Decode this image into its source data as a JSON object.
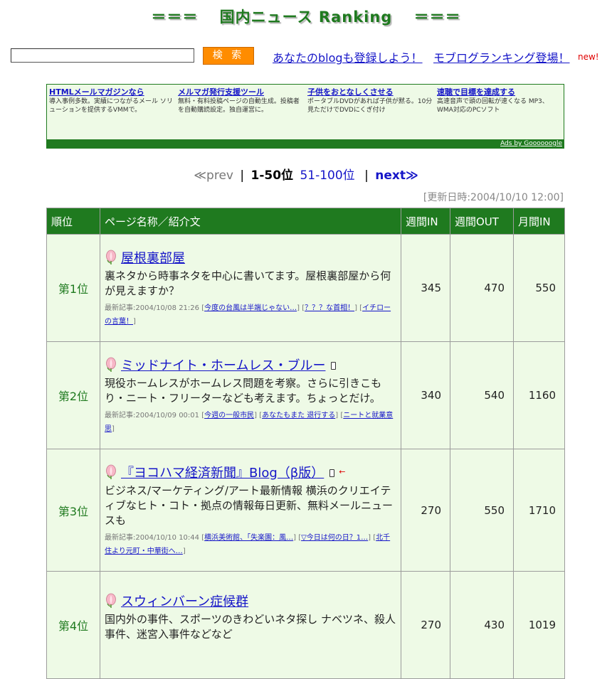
{
  "header": {
    "title": "＝＝＝　 国内ニュース Ranking　 ＝＝＝"
  },
  "search": {
    "button_label": "検 索",
    "value": ""
  },
  "top_links": {
    "register": "あなたのblogも登録しよう！",
    "mobile_ranking": "モブログランキング登場！",
    "new_badge": "new!"
  },
  "ads": {
    "items": [
      {
        "title": "HTMLメールマガジンなら",
        "desc": "導入事例多数。実績につながるメール ソリューションを提供するVMMで。"
      },
      {
        "title": "メルマガ発行支援ツール",
        "desc": "無料・有料投稿ページの自動生成。投稿者を自動購読設定。独自運営に。"
      },
      {
        "title": "子供をおとなしくさせる",
        "desc": "ポータブルDVDがあれば子供が黙る。10分見ただけでDVDにくぎ付け"
      },
      {
        "title": "速聴で目標を達成する",
        "desc": "高速音声で頭の回転が速くなる MP3、WMA対応のPCソフト"
      }
    ],
    "credit": "Ads by Goooooogle"
  },
  "pager": {
    "prev": "≪prev",
    "sep": "|",
    "current": "1-50位",
    "range2": "51-100位",
    "next": "next≫"
  },
  "updated": "[更新日時:2004/10/10 12:00]",
  "table": {
    "headers": [
      "順位",
      "ページ名称／紹介文",
      "週間IN",
      "週間OUT",
      "月間IN"
    ],
    "rows": [
      {
        "rank": "第1位",
        "name": "屋根裏部屋",
        "intro": "裏ネタから時事ネタを中心に書いてます。屋根裏部屋から何が見えますか？",
        "recent_label": "最新記事:",
        "recent_time": "2004/10/08 21:26",
        "articles": [
          "今度の台風は半端じゃない…",
          "？？？な首相！",
          "イチローの言葉！"
        ],
        "week_in": "345",
        "week_out": "470",
        "month_in": "550"
      },
      {
        "rank": "第2位",
        "name": "ミッドナイト・ホームレス・ブルー",
        "intro": "現役ホームレスがホームレス問題を考察。さらに引きこもり・ニート・フリーターなども考えます。ちょっとだけ。",
        "recent_label": "最新記事:",
        "recent_time": "2004/10/09 00:01",
        "articles": [
          "今週の一般市民",
          "あなたもまた 退行する",
          "ニートと就業意思"
        ],
        "week_in": "340",
        "week_out": "540",
        "month_in": "1160"
      },
      {
        "rank": "第3位",
        "name": "『ヨコハマ経済新聞』Blog（β版）",
        "intro": "ビジネス/マーケティング/アート最新情報 横浜のクリエイティブなヒト・コト・拠点の情報毎日更新、無料メールニュースも",
        "recent_label": "最新記事:",
        "recent_time": "2004/10/10 10:44",
        "articles": [
          "横浜美術館、「失楽園：風…",
          "▽今日は何の日？1…",
          "北千住より元町・中華街へ…"
        ],
        "week_in": "270",
        "week_out": "550",
        "month_in": "1710"
      },
      {
        "rank": "第4位",
        "name": "スウィンバーン症候群",
        "intro": "国内外の事件、スポーツのきわどいネタ探し ナベツネ、殺人事件、迷宮入事件などなど",
        "recent_label": "",
        "recent_time": "",
        "articles": [],
        "week_in": "270",
        "week_out": "430",
        "month_in": "1019"
      }
    ]
  }
}
